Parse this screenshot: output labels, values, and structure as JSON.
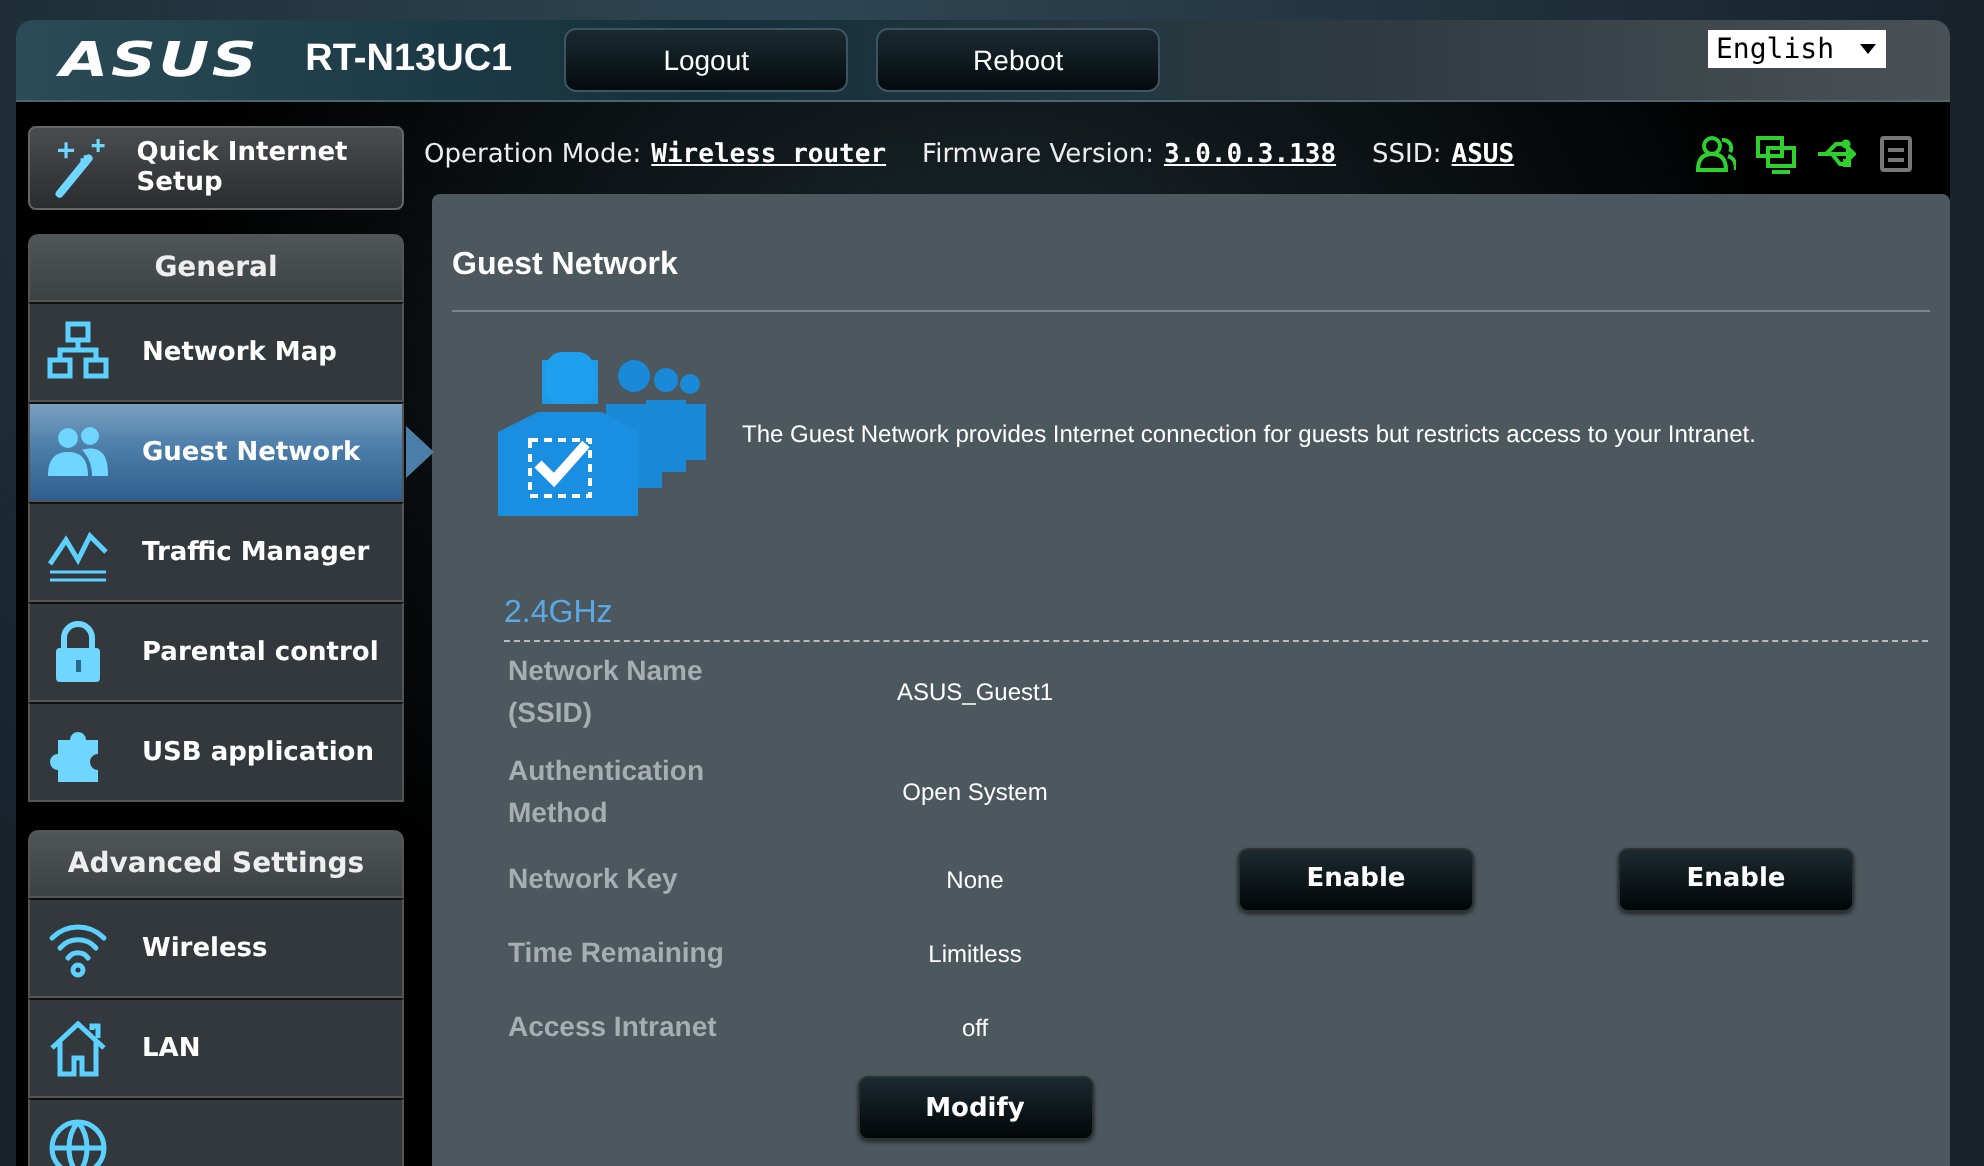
{
  "header": {
    "logo": "ASUS",
    "model": "RT-N13UC1",
    "buttons": [
      "Logout",
      "Reboot"
    ],
    "language": "English"
  },
  "info_bar": {
    "items": [
      {
        "label": "Operation Mode:",
        "value": "Wireless router"
      },
      {
        "label": "Firmware Version:",
        "value": "3.0.0.3.138"
      },
      {
        "label": "SSID:",
        "value": "ASUS"
      }
    ],
    "status_icons": [
      {
        "kind": "clients",
        "on": true
      },
      {
        "kind": "lan",
        "on": true
      },
      {
        "kind": "usb",
        "on": true
      },
      {
        "kind": "printer",
        "on": false
      }
    ]
  },
  "sidebar": {
    "quick_setup": "Quick Internet Setup",
    "sections": [
      {
        "title": "General",
        "items": [
          {
            "label": "Network Map",
            "kind": "network-map",
            "selected": false
          },
          {
            "label": "Guest Network",
            "kind": "guests",
            "selected": true
          },
          {
            "label": "Traffic Manager",
            "kind": "traffic",
            "selected": false
          },
          {
            "label": "Parental control",
            "kind": "lock",
            "selected": false
          },
          {
            "label": "USB application",
            "kind": "puzzle",
            "selected": false
          }
        ]
      },
      {
        "title": "Advanced Settings",
        "items": [
          {
            "label": "Wireless",
            "kind": "wifi",
            "selected": false
          },
          {
            "label": "LAN",
            "kind": "house",
            "selected": false
          },
          {
            "kind": "globe",
            "selected": false
          }
        ]
      }
    ]
  },
  "main": {
    "title": "Guest Network",
    "description": "The Guest Network provides Internet connection for guests but restricts access to your Intranet.",
    "band": "2.4GHz",
    "fields": [
      {
        "label": "Network Name (SSID)",
        "value": "ASUS_Guest1"
      },
      {
        "label": "Authentication Method",
        "value": "Open System"
      },
      {
        "label": "Network Key",
        "value": "None",
        "actions": [
          "Enable",
          "Enable"
        ]
      },
      {
        "label": "Time Remaining",
        "value": "Limitless"
      },
      {
        "label": "Access Intranet",
        "value": "off"
      }
    ],
    "modify_button": "Modify"
  }
}
